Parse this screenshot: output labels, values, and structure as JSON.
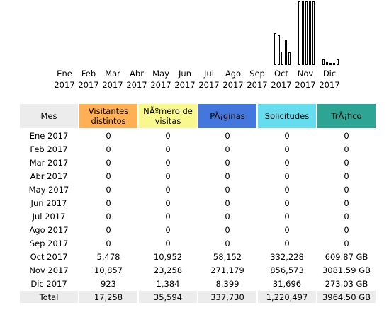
{
  "chart_data": {
    "type": "bar",
    "categories": [
      "Ene 2017",
      "Feb 2017",
      "Mar 2017",
      "Abr 2017",
      "May 2017",
      "Jun 2017",
      "Jul 2017",
      "Ago 2017",
      "Sep 2017",
      "Oct 2017",
      "Nov 2017",
      "Dic 2017"
    ],
    "series": [
      {
        "name": "Visitantes distintos",
        "color": "#ffb055",
        "values": [
          0,
          0,
          0,
          0,
          0,
          0,
          0,
          0,
          0,
          5478,
          10857,
          923
        ]
      },
      {
        "name": "Número de visitas",
        "color": "#f8f88f",
        "values": [
          0,
          0,
          0,
          0,
          0,
          0,
          0,
          0,
          0,
          10952,
          23258,
          1384
        ]
      },
      {
        "name": "Páginas",
        "color": "#4477dd",
        "values": [
          0,
          0,
          0,
          0,
          0,
          0,
          0,
          0,
          0,
          58152,
          271179,
          8399
        ]
      },
      {
        "name": "Solicitudes",
        "color": "#66ddee",
        "values": [
          0,
          0,
          0,
          0,
          0,
          0,
          0,
          0,
          0,
          332228,
          856573,
          31696
        ]
      },
      {
        "name": "Tráfico",
        "color": "#2ea495",
        "values": [
          0,
          0,
          0,
          0,
          0,
          0,
          0,
          0,
          0,
          609.87,
          3081.59,
          273.03
        ]
      }
    ]
  },
  "months": [
    {
      "m": "Ene",
      "y": "2017"
    },
    {
      "m": "Feb",
      "y": "2017"
    },
    {
      "m": "Mar",
      "y": "2017"
    },
    {
      "m": "Abr",
      "y": "2017"
    },
    {
      "m": "May",
      "y": "2017"
    },
    {
      "m": "Jun",
      "y": "2017"
    },
    {
      "m": "Jul",
      "y": "2017"
    },
    {
      "m": "Ago",
      "y": "2017"
    },
    {
      "m": "Sep",
      "y": "2017"
    },
    {
      "m": "Oct",
      "y": "2017"
    },
    {
      "m": "Nov",
      "y": "2017"
    },
    {
      "m": "Dic",
      "y": "2017"
    }
  ],
  "table": {
    "headers": {
      "month": "Mes",
      "visitors": "Visitantes distintos",
      "visits": "NÃºmero de visitas",
      "pages": "PÃ¡ginas",
      "hits": "Solicitudes",
      "bandwidth": "TrÃ¡fico"
    },
    "rows": [
      [
        "Ene 2017",
        "0",
        "0",
        "0",
        "0",
        "0"
      ],
      [
        "Feb 2017",
        "0",
        "0",
        "0",
        "0",
        "0"
      ],
      [
        "Mar 2017",
        "0",
        "0",
        "0",
        "0",
        "0"
      ],
      [
        "Abr 2017",
        "0",
        "0",
        "0",
        "0",
        "0"
      ],
      [
        "May 2017",
        "0",
        "0",
        "0",
        "0",
        "0"
      ],
      [
        "Jun 2017",
        "0",
        "0",
        "0",
        "0",
        "0"
      ],
      [
        "Jul 2017",
        "0",
        "0",
        "0",
        "0",
        "0"
      ],
      [
        "Ago 2017",
        "0",
        "0",
        "0",
        "0",
        "0"
      ],
      [
        "Sep 2017",
        "0",
        "0",
        "0",
        "0",
        "0"
      ],
      [
        "Oct 2017",
        "5,478",
        "10,952",
        "58,152",
        "332,228",
        "609.87 GB"
      ],
      [
        "Nov 2017",
        "10,857",
        "23,258",
        "271,179",
        "856,573",
        "3081.59 GB"
      ],
      [
        "Dic 2017",
        "923",
        "1,384",
        "8,399",
        "31,696",
        "273.03 GB"
      ]
    ],
    "total": [
      "Total",
      "17,258",
      "35,594",
      "337,730",
      "1,220,497",
      "3964.50 GB"
    ]
  }
}
